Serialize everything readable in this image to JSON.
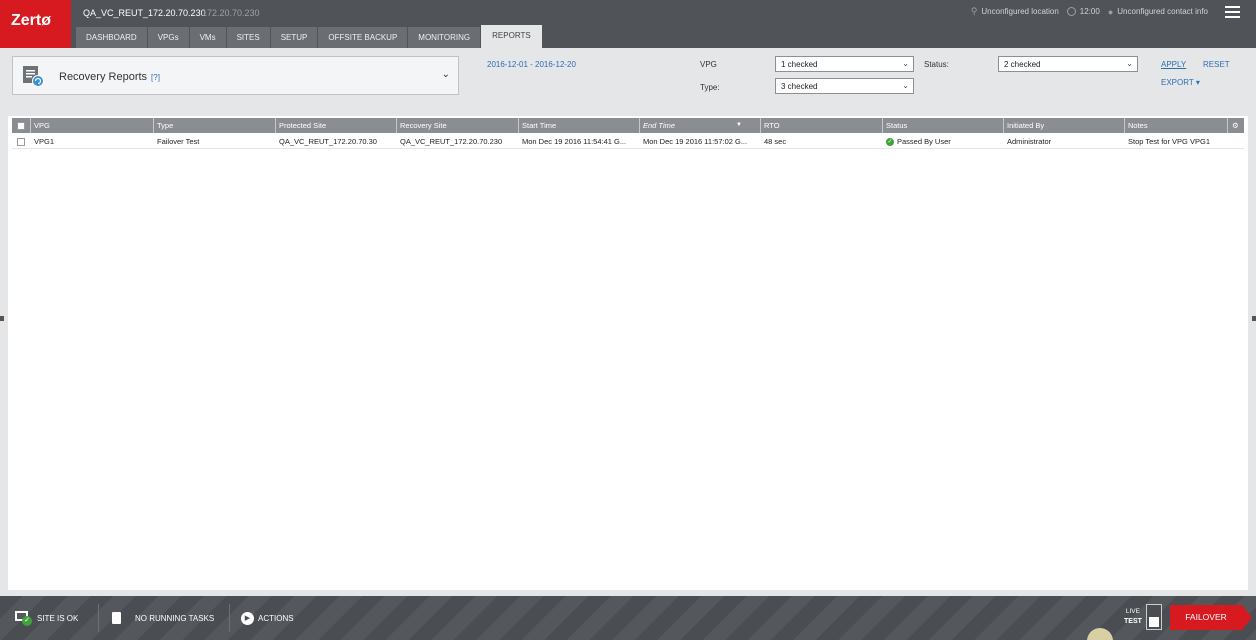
{
  "header": {
    "logo_text": "Zertø",
    "site_name": "QA_VC_REUT_172.20.70.230",
    "site_ip": "172.20.70.230",
    "location": "Unconfigured location",
    "time": "12:00",
    "contact": "Unconfigured contact info",
    "tabs": [
      "DASHBOARD",
      "VPGs",
      "VMs",
      "SITES",
      "SETUP",
      "OFFSITE BACKUP",
      "MONITORING",
      "REPORTS"
    ],
    "active_tab": "REPORTS"
  },
  "filters": {
    "report_title": "Recovery Reports",
    "report_help": "[?]",
    "date_range": "2016-12-01 - 2016-12-20",
    "vpg_label": "VPG",
    "vpg_value": "1 checked",
    "type_label": "Type:",
    "type_value": "3 checked",
    "status_label": "Status:",
    "status_value": "2 checked",
    "apply_label": "APPLY",
    "reset_label": "RESET",
    "export_label": "EXPORT ▾"
  },
  "table": {
    "columns": [
      "VPG",
      "Type",
      "Protected Site",
      "Recovery Site",
      "Start Time",
      "End Time",
      "RTO",
      "Status",
      "Initiated By",
      "Notes"
    ],
    "sorted_column": "End Time",
    "rows": [
      {
        "vpg": "VPG1",
        "type": "Failover Test",
        "protected_site": "QA_VC_REUT_172.20.70.30",
        "recovery_site": "QA_VC_REUT_172.20.70.230",
        "start_time": "Mon Dec 19 2016 11:54:41 G...",
        "end_time": "Mon Dec 19 2016 11:57:02 G...",
        "rto": "48 sec",
        "status": "Passed By User",
        "initiated_by": "Administrator",
        "notes": "Stop Test for VPG VPG1"
      }
    ]
  },
  "footer": {
    "site_status": "SITE IS OK",
    "tasks": "NO RUNNING TASKS",
    "actions": "ACTIONS",
    "live_label": "LIVE",
    "test_label": "TEST",
    "failover_label": "FAILOVER"
  },
  "colors": {
    "brand_red": "#d71920",
    "header_bg": "#505458",
    "link_blue": "#2e6db4",
    "status_green": "#3fa33a"
  }
}
